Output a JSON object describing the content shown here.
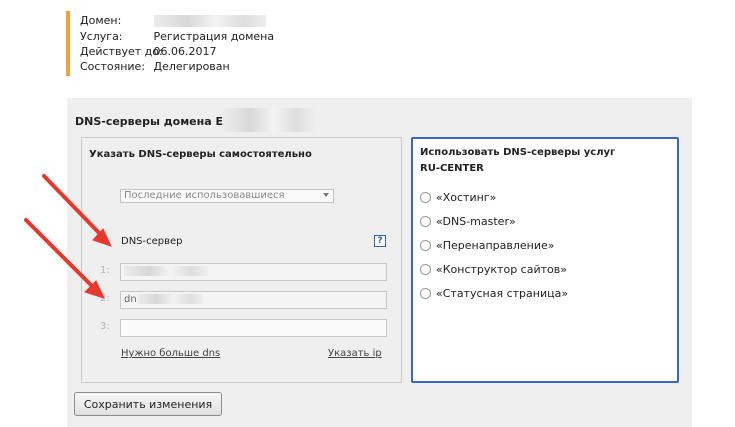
{
  "domain_info": {
    "domain_label": "Домен:",
    "service_label": "Услуга:",
    "service_value": "Регистрация домена",
    "valid_label": "Действует до:",
    "valid_value": "06.06.2017",
    "state_label": "Состояние:",
    "state_value": "Делегирован",
    "accent_color": "#f2a23a"
  },
  "panel": {
    "title": "DNS-серверы домена Е",
    "left_box": {
      "title": "Указать DNS-серверы самостоятельно",
      "select_value": "Последние использовавшиеся",
      "dns_label": "DNS-сервер",
      "help_icon": "?",
      "servers": [
        {
          "num": "1:",
          "value": ""
        },
        {
          "num": "2:",
          "value": "dn"
        },
        {
          "num": "3:",
          "value": ""
        }
      ],
      "more_link": "Нужно больше dns",
      "ip_link": "Указать ip"
    },
    "right_box": {
      "title_line1": "Использовать DNS-серверы услуг",
      "title_line2": "RU-CENTER",
      "options": [
        "«Хостинг»",
        "«DNS-master»",
        "«Перенаправление»",
        "«Конструктор сайтов»",
        "«Статусная страница»"
      ],
      "border_color": "#3a66c4"
    },
    "save_button": "Сохранить изменения"
  },
  "annotation_color": "#e8382c"
}
